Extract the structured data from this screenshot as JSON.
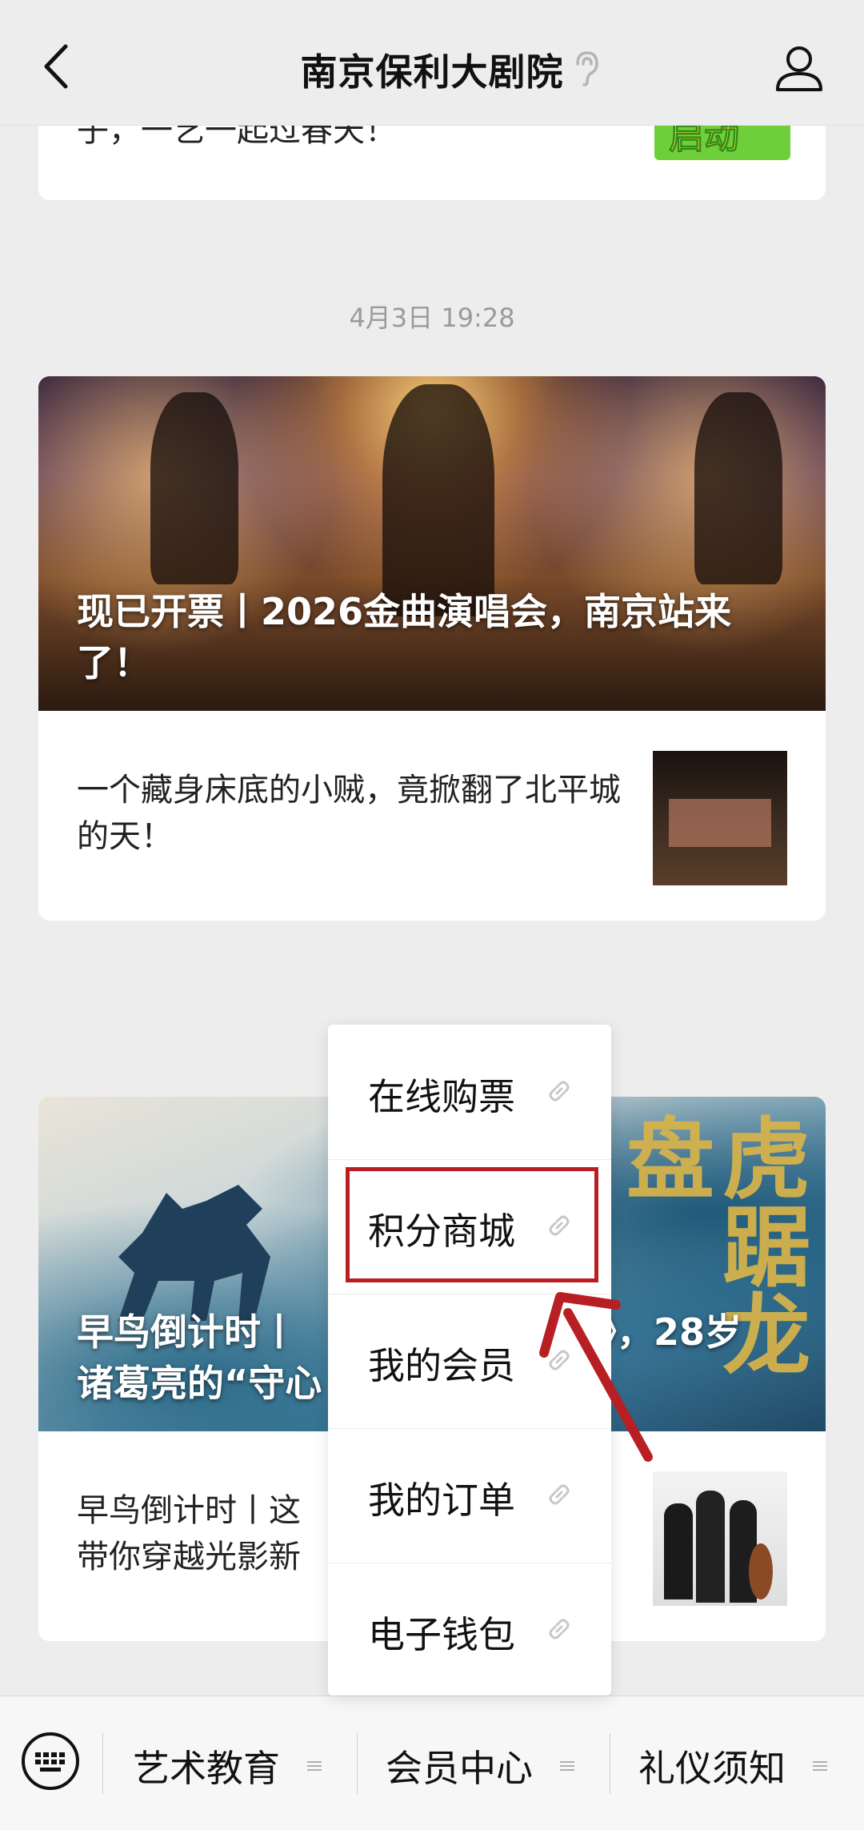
{
  "header": {
    "title": "南京保利大剧院",
    "back_icon": "back-arrow-icon",
    "ear_icon": "ear-icon",
    "profile_icon": "user-profile-icon"
  },
  "feed": {
    "top_card_partial_text": "子，一艺一起过春天！",
    "top_card_badge_text": "启动",
    "timestamp": "4月3日 19:28",
    "article1": {
      "title": "现已开票丨2026金曲演唱会，南京站来了！",
      "sub_title": "一个藏身床底的小贼，竟掀翻了北平城的天！"
    },
    "article2": {
      "title_visible_left_line1": "早鸟倒计时丨",
      "title_visible_right_line1": "》，28岁",
      "title_visible_line2": "诸葛亮的“守心",
      "calligraphy": "虎踞龙盘",
      "sub_title_line1": "早鸟倒计时丨这",
      "sub_title_line2": "带你穿越光影新"
    }
  },
  "popup_menu": {
    "items": [
      {
        "label": "在线购票"
      },
      {
        "label": "积分商城"
      },
      {
        "label": "我的会员"
      },
      {
        "label": "我的订单"
      },
      {
        "label": "电子钱包"
      }
    ],
    "highlighted_index": 1
  },
  "bottom_menu": {
    "keyboard_icon": "keyboard-icon",
    "items": [
      {
        "label": "艺术教育"
      },
      {
        "label": "会员中心"
      },
      {
        "label": "礼仪须知"
      }
    ]
  },
  "colors": {
    "background": "#ededed",
    "highlight": "#b81f22",
    "badge": "#6fcf3a"
  }
}
